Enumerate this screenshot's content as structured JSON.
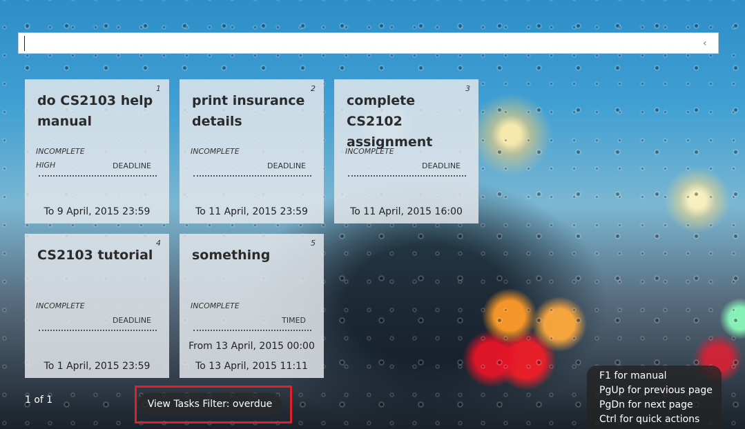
{
  "command_bar": {
    "value": "",
    "placeholder": ""
  },
  "tasks": [
    {
      "index": "1",
      "title": "do CS2103 help manual",
      "status": "INCOMPLETE",
      "priority": "HIGH",
      "type": "DEADLINE",
      "from": "",
      "to": "To 9 April, 2015 23:59"
    },
    {
      "index": "2",
      "title": "print insurance details",
      "status": "INCOMPLETE",
      "priority": "",
      "type": "DEADLINE",
      "from": "",
      "to": "To 11 April, 2015 23:59"
    },
    {
      "index": "3",
      "title": "complete CS2102 assignment",
      "status": "INCOMPLETE",
      "priority": "",
      "type": "DEADLINE",
      "from": "",
      "to": "To 11 April, 2015 16:00"
    },
    {
      "index": "4",
      "title": "CS2103 tutorial",
      "status": "INCOMPLETE",
      "priority": "",
      "type": "DEADLINE",
      "from": "",
      "to": "To 1 April, 2015 23:59"
    },
    {
      "index": "5",
      "title": "something",
      "status": "INCOMPLETE",
      "priority": "",
      "type": "TIMED",
      "from": "From 13 April, 2015 00:00",
      "to": "To 13 April, 2015 11:11"
    }
  ],
  "footer": {
    "page_indicator": "1 of 1",
    "filter_label": "View Tasks Filter: overdue",
    "highlight_color": "#e3202a"
  },
  "help": {
    "lines": [
      "F1 for manual",
      "PgUp for previous page",
      "PgDn for next page",
      "Ctrl for quick actions"
    ]
  },
  "icons": {
    "command_collapse": "chevron-left-icon"
  }
}
